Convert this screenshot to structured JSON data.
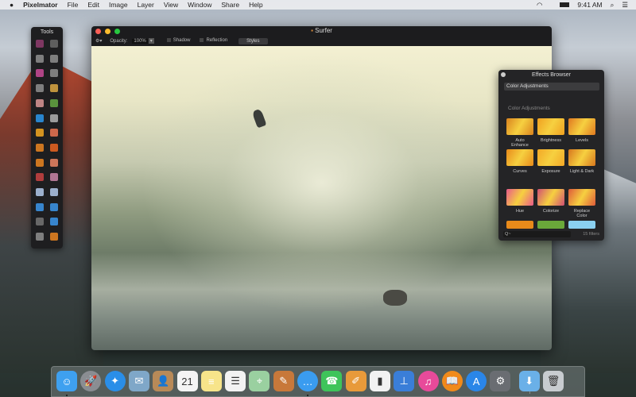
{
  "menubar": {
    "apple": "",
    "app": "Pixelmator",
    "items": [
      "File",
      "Edit",
      "Image",
      "Layer",
      "View",
      "Window",
      "Share",
      "Help"
    ],
    "time": "9:41 AM"
  },
  "tools": {
    "title": "Tools"
  },
  "window": {
    "title": "Surfer",
    "opacity_label": "Opacity:",
    "opacity_value": "100%",
    "shadow": "Shadow",
    "reflection": "Reflection",
    "styles": "Styles"
  },
  "effects": {
    "title": "Effects Browser",
    "category": "Color Adjustments",
    "section": "Color Adjustments",
    "items": [
      {
        "label": "Auto Enhance",
        "color": "#d9821e"
      },
      {
        "label": "Brightness",
        "color": "#f0a020"
      },
      {
        "label": "Levels",
        "color": "#e07820"
      },
      {
        "label": "Curves",
        "color": "#e88a1a"
      },
      {
        "label": "Exposure",
        "color": "#f3a726"
      },
      {
        "label": "Light & Dark",
        "color": "#d7761e"
      },
      {
        "label": "Hue",
        "color": "#e85a8a"
      },
      {
        "label": "Colorize",
        "color": "#d04e74"
      },
      {
        "label": "Replace Color",
        "color": "#de5a3a"
      }
    ],
    "search_placeholder": "Q~",
    "count": "15 filters"
  },
  "dock": {
    "items": [
      {
        "name": "finder",
        "color": "#3ea0f0",
        "glyph": "☺"
      },
      {
        "name": "launchpad",
        "color": "#8a8d92",
        "glyph": "🚀"
      },
      {
        "name": "safari",
        "color": "#2a8ee8",
        "glyph": "✦"
      },
      {
        "name": "preview",
        "color": "#7fa7c8",
        "glyph": "✉"
      },
      {
        "name": "contacts",
        "color": "#b88a58",
        "glyph": "👤"
      },
      {
        "name": "calendar",
        "color": "#f4f4f4",
        "glyph": "21"
      },
      {
        "name": "notes",
        "color": "#f7e48a",
        "glyph": "≡"
      },
      {
        "name": "reminders",
        "color": "#f2f2f2",
        "glyph": "☰"
      },
      {
        "name": "maps",
        "color": "#9ad0a0",
        "glyph": "⌖"
      },
      {
        "name": "pixelmator",
        "color": "#c8783a",
        "glyph": "✎"
      },
      {
        "name": "messages",
        "color": "#3a9cf0",
        "glyph": "…"
      },
      {
        "name": "facetime",
        "color": "#3ec45a",
        "glyph": "☎"
      },
      {
        "name": "pages",
        "color": "#e89a3a",
        "glyph": "✐"
      },
      {
        "name": "numbers",
        "color": "#f2f2f2",
        "glyph": "▮"
      },
      {
        "name": "keynote",
        "color": "#3a7ed8",
        "glyph": "⊥"
      },
      {
        "name": "itunes",
        "color": "#e84a9a",
        "glyph": "♫"
      },
      {
        "name": "ibooks",
        "color": "#f08a1a",
        "glyph": "📖"
      },
      {
        "name": "app-store",
        "color": "#2a86e8",
        "glyph": "A"
      },
      {
        "name": "system-preferences",
        "color": "#6a6d72",
        "glyph": "⚙"
      },
      {
        "name": "downloads",
        "color": "#6ab0e8",
        "glyph": "⬇"
      },
      {
        "name": "trash",
        "color": "#c8ccd0",
        "glyph": "🗑"
      }
    ]
  }
}
